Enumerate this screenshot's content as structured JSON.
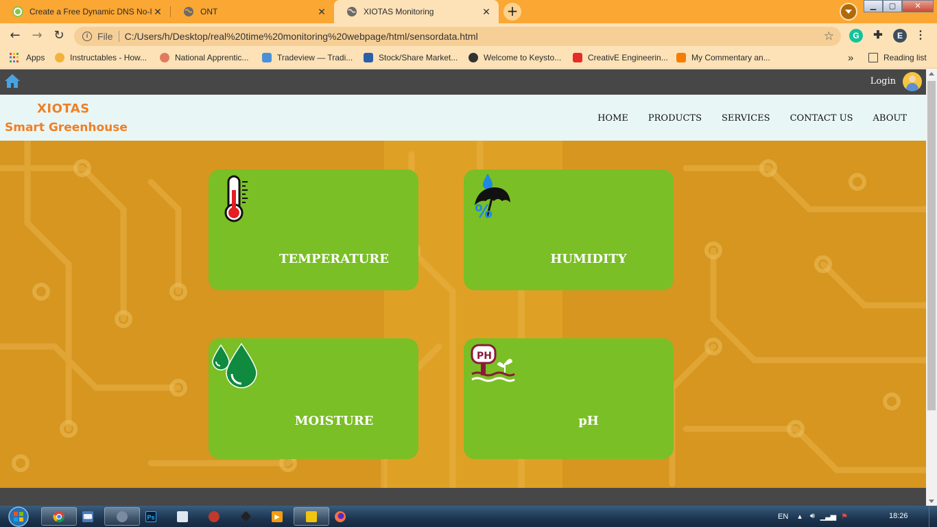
{
  "browser": {
    "tabs": [
      {
        "title": "Create a Free Dynamic DNS No-I",
        "favicon": "no-ip-favicon-icon",
        "active": false
      },
      {
        "title": "ONT",
        "favicon": "globe-icon",
        "active": false
      },
      {
        "title": "XIOTAS Monitoring",
        "favicon": "globe-icon",
        "active": true
      }
    ],
    "new_tab_label": "+",
    "url_scheme_label": "File",
    "url": "C:/Users/h/Desktop/real%20time%20monitoring%20webpage/html/sensordata.html",
    "profile_initial": "E",
    "grammarly_initial": "G"
  },
  "bookmarks": {
    "apps_label": "Apps",
    "items": [
      {
        "label": "Instructables - How...",
        "color": "#f2b33d"
      },
      {
        "label": "National Apprentic...",
        "color": "#e07b5f"
      },
      {
        "label": "Tradeview — Tradi...",
        "color": "#4a90d9"
      },
      {
        "label": "Stock/Share Market...",
        "color": "#2b5fa8"
      },
      {
        "label": "Welcome to Keysto...",
        "color": "#333333"
      },
      {
        "label": "CreativE Engineerin...",
        "color": "#e52d27"
      },
      {
        "label": "My Commentary an...",
        "color": "#f57d00"
      }
    ],
    "overflow_label": "»",
    "reading_list_label": "Reading list"
  },
  "site": {
    "login_label": "Login",
    "brand_line1": "XIOTAS",
    "brand_line2": "Smart Greenhouse",
    "nav": [
      "HOME",
      "PRODUCTS",
      "SERVICES",
      "CONTACT US",
      "ABOUT"
    ],
    "cards": [
      {
        "label": "TEMPERATURE",
        "icon": "thermometer-icon"
      },
      {
        "label": "HUMIDITY",
        "icon": "humidity-umbrella-icon"
      },
      {
        "label": "MOISTURE",
        "icon": "water-drops-icon"
      },
      {
        "label": "pH",
        "icon": "ph-meter-icon"
      }
    ],
    "colors": {
      "topbar": "#474747",
      "header_bg": "#e9f6f6",
      "brand": "#f07f22",
      "card": "#7abf25",
      "hero": "#d9981f"
    }
  },
  "taskbar": {
    "language": "EN",
    "clock": "18:26",
    "apps": [
      "chrome-icon",
      "keyboard-icon",
      "app-icon",
      "photoshop-icon",
      "notepad-icon",
      "media-icon",
      "inkscape-icon",
      "vlc-icon",
      "explorer-icon",
      "firefox-icon"
    ],
    "photoshop_label": "Ps"
  }
}
